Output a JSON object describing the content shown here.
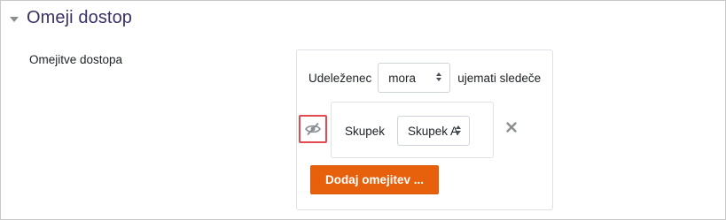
{
  "section": {
    "title": "Omeji dostop",
    "field_label": "Omejitve dostopa"
  },
  "restriction": {
    "prefix": "Udeleženec",
    "must_select": {
      "selected": "mora"
    },
    "suffix": "ujemati sledeče"
  },
  "condition": {
    "label": "Skupek",
    "group_select": {
      "selected": "Skupek A"
    }
  },
  "actions": {
    "add_label": "Dodaj omejitev ..."
  },
  "icons": {
    "collapse": "caret-down-icon",
    "visibility": "eye-slash-icon",
    "delete": "close-icon"
  },
  "colors": {
    "title": "#3c3166",
    "button": "#e7600b",
    "highlight": "#e34a4f"
  }
}
